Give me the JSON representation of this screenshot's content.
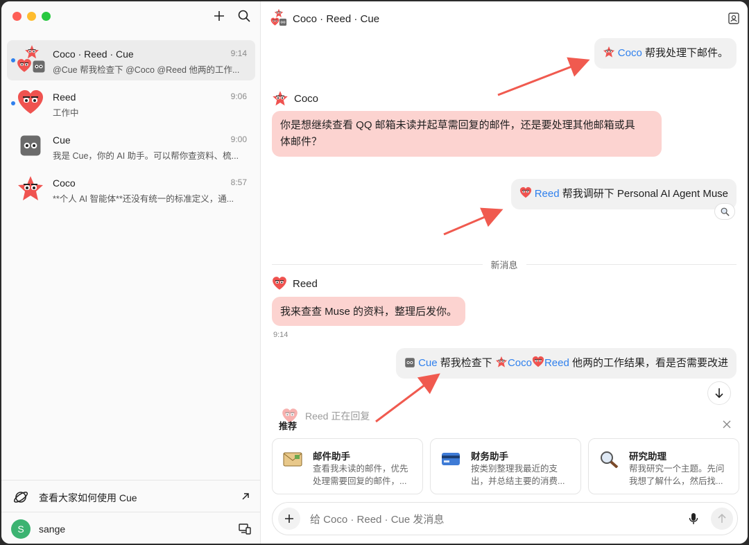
{
  "sidebar": {
    "conversations": [
      {
        "name": "Coco · Reed · Cue",
        "time": "9:14",
        "preview": "@Cue 帮我检查下 @Coco @Reed 他两的工作..."
      },
      {
        "name": "Reed",
        "time": "9:06",
        "preview": "工作中"
      },
      {
        "name": "Cue",
        "time": "9:00",
        "preview": "我是 Cue，你的 AI 助手。可以帮你查资料、梳..."
      },
      {
        "name": "Coco",
        "time": "8:57",
        "preview": "**个人 AI 智能体**还没有统一的标准定义，通..."
      }
    ],
    "explore_label": "查看大家如何使用 Cue",
    "user": {
      "initial": "S",
      "name": "sange"
    }
  },
  "chat": {
    "title": "Coco · Reed · Cue",
    "msg1": {
      "mention": "Coco",
      "text": " 帮我处理下邮件。"
    },
    "msg2": {
      "sender": "Coco",
      "line1": "你是想继续查看 QQ 邮箱未读并起草需回复的邮件，还是要处理其他邮箱或具",
      "line2": "体邮件？"
    },
    "msg3": {
      "mention": "Reed",
      "text": " 帮我调研下 Personal AI Agent Muse"
    },
    "divider": "新消息",
    "msg4": {
      "sender": "Reed",
      "text": "我来查查 Muse 的资料，整理后发你。",
      "time": "9:14"
    },
    "msg5": {
      "mention1": "Cue",
      "text1": " 帮我检查下 ",
      "mention2": "Coco",
      "mention3": "Reed",
      "text2": " 他两的工作结果，看是否需要改进"
    },
    "typing": "Reed 正在回复"
  },
  "recommend": {
    "title": "推荐",
    "cards": [
      {
        "title": "邮件助手",
        "desc": "查看我未读的邮件，优先处理需要回复的邮件，..."
      },
      {
        "title": "财务助手",
        "desc": "按类别整理我最近的支出，并总结主要的消费..."
      },
      {
        "title": "研究助理",
        "desc": "帮我研究一个主题。先问我想了解什么，然后找..."
      }
    ]
  },
  "composer": {
    "placeholder": "给 Coco · Reed · Cue 发消息"
  },
  "colors": {
    "accent": "#2f80ed",
    "bot_bubble": "#fcd3d0",
    "user_bubble": "#f1f1f1",
    "arrow": "#f05a4f",
    "avatar_green": "#3cb371"
  }
}
